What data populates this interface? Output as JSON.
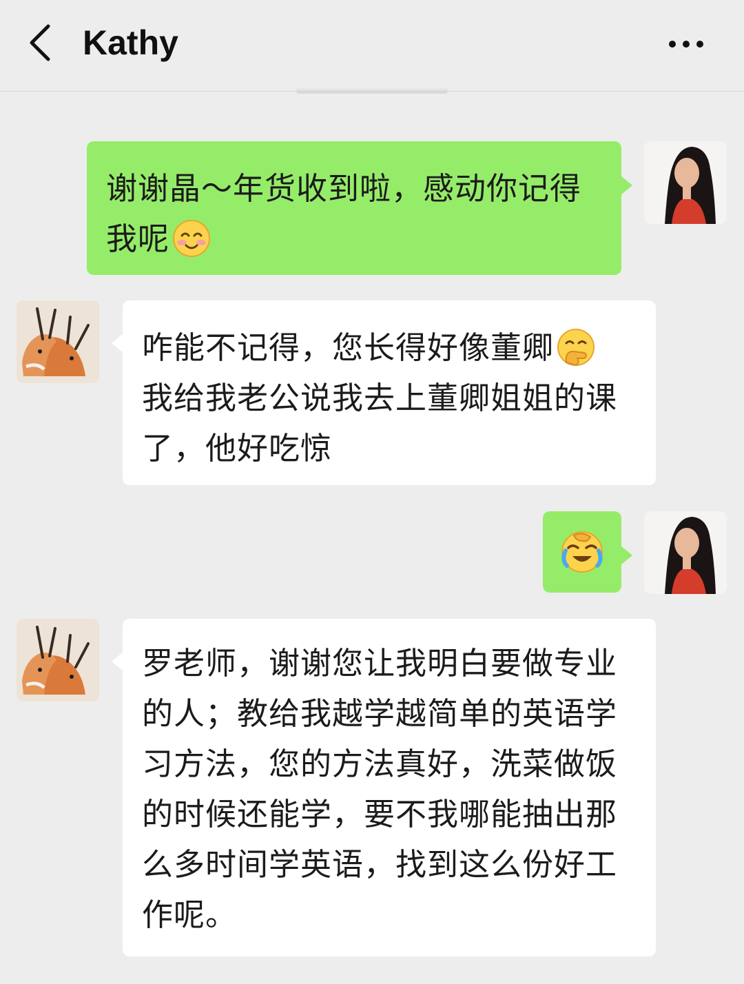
{
  "header": {
    "title": "Kathy",
    "back_icon": "chevron-left-icon",
    "more_icon": "ellipsis-icon"
  },
  "colors": {
    "background": "#ededed",
    "outgoing_bubble": "#95ec69",
    "incoming_bubble": "#ffffff"
  },
  "messages": [
    {
      "direction": "outgoing",
      "text": "谢谢晶～年货收到啦，感动你记得我呢",
      "emoji": "smiling-blush-emoji"
    },
    {
      "direction": "incoming",
      "text": "咋能不记得，您长得好像董卿",
      "emoji": "hand-over-mouth-emoji",
      "text2": "我给我老公说我去上董卿姐姐的课了，他好吃惊"
    },
    {
      "direction": "outgoing",
      "text": "",
      "emoji": "rolling-laughing-emoji"
    },
    {
      "direction": "incoming",
      "text": "罗老师，谢谢您让我明白要做专业的人；教给我越学越简单的英语学习方法，您的方法真好，洗菜做饭的时候还能学，要不我哪能抽出那么多时间学英语，找到这么份好工作呢。"
    }
  ]
}
